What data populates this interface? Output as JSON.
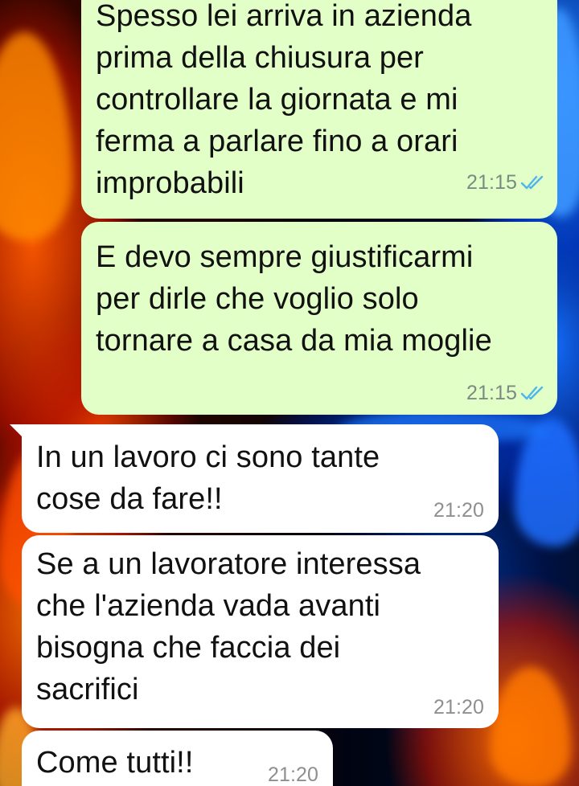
{
  "chat": {
    "messages": [
      {
        "direction": "outgoing",
        "text": "Spesso lei arriva in azienda\nprima della chiusura per\ncontrollare la giornata e mi\nferma a parlare fino a orari\nimprobabili",
        "time": "21:15",
        "status": "read"
      },
      {
        "direction": "outgoing",
        "text": "E devo sempre giustificarmi\nper dirle che voglio solo\ntornare a casa da mia moglie",
        "time": "21:15",
        "status": "read"
      },
      {
        "direction": "incoming",
        "text": "In un lavoro ci sono tante\ncose da fare!!",
        "time": "21:20"
      },
      {
        "direction": "incoming",
        "text": "Se a un lavoratore interessa\nche l'azienda vada avanti\nbisogna che faccia dei\nsacrifici",
        "time": "21:20"
      },
      {
        "direction": "incoming",
        "text": "Come tutti!!",
        "time": "21:20"
      }
    ]
  },
  "colors": {
    "outgoing_bubble": "#e2ffc8",
    "incoming_bubble": "#ffffff",
    "read_ticks": "#4fb6ec",
    "wallpaper_left": "fire-red-orange",
    "wallpaper_right": "ice-blue"
  },
  "icons": {
    "read_status": "double-check-icon"
  }
}
